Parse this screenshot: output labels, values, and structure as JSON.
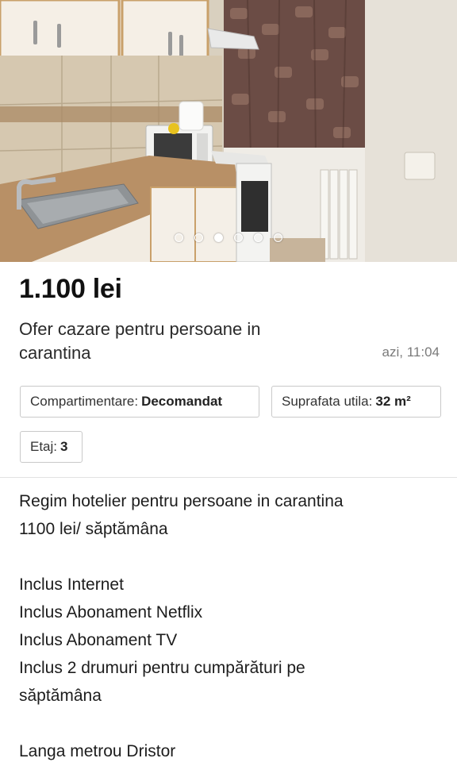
{
  "listing": {
    "price": "1.100 lei",
    "title": "Ofer cazare pentru persoane in carantina",
    "posted_time": "azi, 11:04"
  },
  "gallery": {
    "photo_description_icon": "kitchen-photo",
    "photo_count": 6,
    "active_index": 2
  },
  "attributes": {
    "partitioning_label": "Compartimentare:",
    "partitioning_value": "Decomandat",
    "area_label": "Suprafata utila:",
    "area_value": "32 m²",
    "floor_label": "Etaj:",
    "floor_value": "3"
  },
  "description": {
    "line1": "Regim hotelier pentru persoane in carantina",
    "line2": "1100 lei/ săptămâna",
    "line3": "Inclus Internet",
    "line4": "Inclus Abonament Netflix",
    "line5": "Inclus Abonament TV",
    "line6": "Inclus 2 drumuri pentru cumpărături pe",
    "line7": "săptămâna",
    "line8": "Langa metrou Dristor"
  }
}
